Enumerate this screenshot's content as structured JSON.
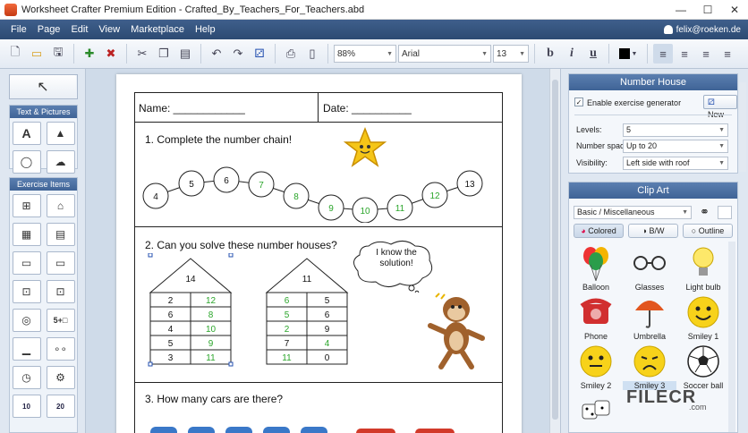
{
  "window": {
    "title": "Worksheet Crafter Premium Edition - Crafted_By_Teachers_For_Teachers.abd",
    "minimize": "—",
    "maximize": "☐",
    "close": "✕"
  },
  "menu": {
    "items": [
      "File",
      "Page",
      "Edit",
      "View",
      "Marketplace",
      "Help"
    ],
    "user": "felix@roeken.de"
  },
  "toolbar": {
    "zoom": "88%",
    "font": "Arial",
    "font_size": "13",
    "bold": "b",
    "italic": "i",
    "underline": "u"
  },
  "left_panel": {
    "pointer": "↖",
    "text_pictures_header": "Text & Pictures",
    "text_pictures_items": [
      "A",
      "▲",
      "◯",
      "☁"
    ],
    "exercise_header": "Exercise Items",
    "exercise_items": [
      "⊞",
      "⌂",
      "▦",
      "▤",
      "▭",
      "▭",
      "⊡",
      "⊡",
      "◎",
      "5+□",
      "▁",
      "∘∘",
      "◷",
      "⚙",
      "10",
      "20"
    ]
  },
  "worksheet": {
    "name_label": "Name: ____________",
    "date_label": "Date: __________",
    "q1": "1. Complete the number chain!",
    "chain": [
      "4",
      "5",
      "6",
      "7",
      "8",
      "9",
      "10",
      "11",
      "12",
      "13"
    ],
    "chain_colors": [
      "#111111",
      "#111111",
      "#111111",
      "#2aa52a",
      "#2aa52a",
      "#2aa52a",
      "#2aa52a",
      "#2aa52a",
      "#2aa52a",
      "#111111"
    ],
    "q2": "2. Can you solve these number houses?",
    "house1_roof": "14",
    "house1_rows": [
      [
        "2",
        "12"
      ],
      [
        "6",
        "8"
      ],
      [
        "4",
        "10"
      ],
      [
        "5",
        "9"
      ],
      [
        "3",
        "11"
      ]
    ],
    "house1_green": [
      "right",
      "right",
      "right",
      "right",
      "right"
    ],
    "house2_roof": "11",
    "house2_rows": [
      [
        "6",
        "5"
      ],
      [
        "5",
        "6"
      ],
      [
        "2",
        "9"
      ],
      [
        "7",
        "4"
      ],
      [
        "11",
        "0"
      ]
    ],
    "house2_green": [
      "left",
      "left",
      "left",
      "right",
      "left"
    ],
    "bubble": "I know the solution!",
    "q3": "3. How many cars are there?",
    "green": "#2aa52a"
  },
  "number_house_panel": {
    "header": "Number House",
    "enable_label": "Enable exercise generator",
    "enabled_mark": "✓",
    "new_button": "New",
    "levels_label": "Levels:",
    "levels_value": "5",
    "space_label": "Number space:",
    "space_value": "Up to 20",
    "visibility_label": "Visibility:",
    "visibility_value": "Left side with roof"
  },
  "clip_art_panel": {
    "header": "Clip Art",
    "category": "Basic / Miscellaneous",
    "tabs": [
      "Colored",
      "B/W",
      "Outline"
    ],
    "items": [
      "Balloon",
      "Glasses",
      "Light bulb",
      "Phone",
      "Umbrella",
      "Smiley 1",
      "Smiley 2",
      "Smiley 3",
      "Soccer ball"
    ]
  },
  "watermark": {
    "main": "FILECR",
    "sub": ".com"
  }
}
